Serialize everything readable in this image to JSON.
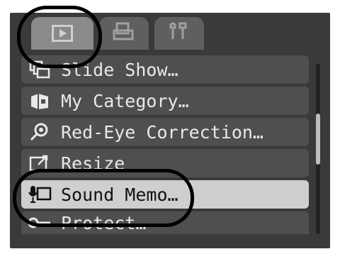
{
  "tabs": [
    {
      "name": "play",
      "icon": "play-icon"
    },
    {
      "name": "print",
      "icon": "print-icon"
    },
    {
      "name": "setup",
      "icon": "tools-icon"
    }
  ],
  "menu": {
    "items": [
      {
        "label": "Slide Show…",
        "icon": "slide-show-icon"
      },
      {
        "label": "My Category…",
        "icon": "my-category-icon"
      },
      {
        "label": "Red-Eye Correction…",
        "icon": "red-eye-icon"
      },
      {
        "label": "Resize",
        "icon": "resize-icon"
      },
      {
        "label": "Sound Memo…",
        "icon": "sound-memo-icon",
        "selected": true
      },
      {
        "label": "Protect…",
        "icon": "protect-icon"
      }
    ]
  },
  "colors": {
    "screen_bg": "#3a3a3a",
    "item_bg": "#4f4f4f",
    "selected_bg": "#cfcfcf",
    "text": "#e9e9e9",
    "ring": "#000000"
  }
}
